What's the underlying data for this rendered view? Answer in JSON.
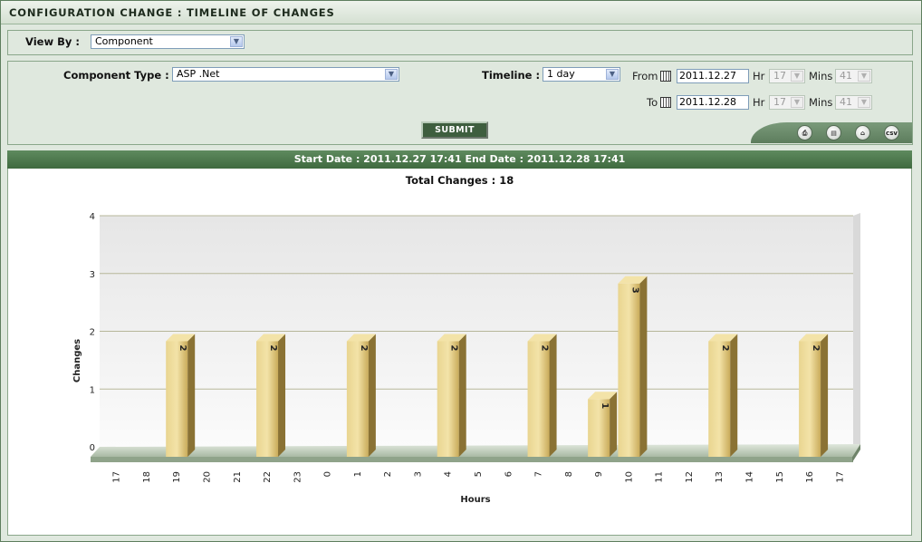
{
  "header": {
    "title": "CONFIGURATION CHANGE : TIMELINE OF CHANGES"
  },
  "view_by": {
    "label": "View By  :",
    "value": "Component"
  },
  "filters": {
    "component_type_label": "Component Type :",
    "component_type_value": "ASP .Net",
    "timeline_label": "Timeline :",
    "timeline_value": "1 day",
    "from_label": "From",
    "from_date": "2011.12.27",
    "to_label": "To",
    "to_date": "2011.12.28",
    "hr_label": "Hr",
    "mins_label": "Mins",
    "from_hr": "17",
    "from_mins": "41",
    "to_hr": "17",
    "to_mins": "41",
    "submit_label": "SUBMIT"
  },
  "tools": [
    {
      "name": "print-icon",
      "glyph": "⎙"
    },
    {
      "name": "pdf-icon",
      "glyph": "▤"
    },
    {
      "name": "home-icon",
      "glyph": "⌂"
    },
    {
      "name": "csv-icon",
      "glyph": "csv"
    }
  ],
  "date_bar": {
    "text": "Start Date : 2011.12.27 17:41    End Date : 2011.12.28 17:41"
  },
  "total": {
    "text": "Total Changes : 18"
  },
  "chart_data": {
    "type": "bar",
    "xlabel": "Hours",
    "ylabel": "Changes",
    "ylim": [
      0,
      4
    ],
    "yticks": [
      0,
      1,
      2,
      3,
      4
    ],
    "categories": [
      "17",
      "18",
      "19",
      "20",
      "21",
      "22",
      "23",
      "0",
      "1",
      "2",
      "3",
      "4",
      "5",
      "6",
      "7",
      "8",
      "9",
      "10",
      "11",
      "12",
      "13",
      "14",
      "15",
      "16",
      "17"
    ],
    "values": [
      0,
      0,
      2,
      0,
      0,
      2,
      0,
      0,
      2,
      0,
      0,
      2,
      0,
      0,
      2,
      0,
      1,
      3,
      0,
      0,
      2,
      0,
      0,
      2,
      0
    ],
    "grid": true,
    "colors": {
      "bar_front": "#d8bf74",
      "bar_side": "#8a7234",
      "bar_top": "#f3e3a8",
      "floor": "#c8d3c4"
    }
  }
}
